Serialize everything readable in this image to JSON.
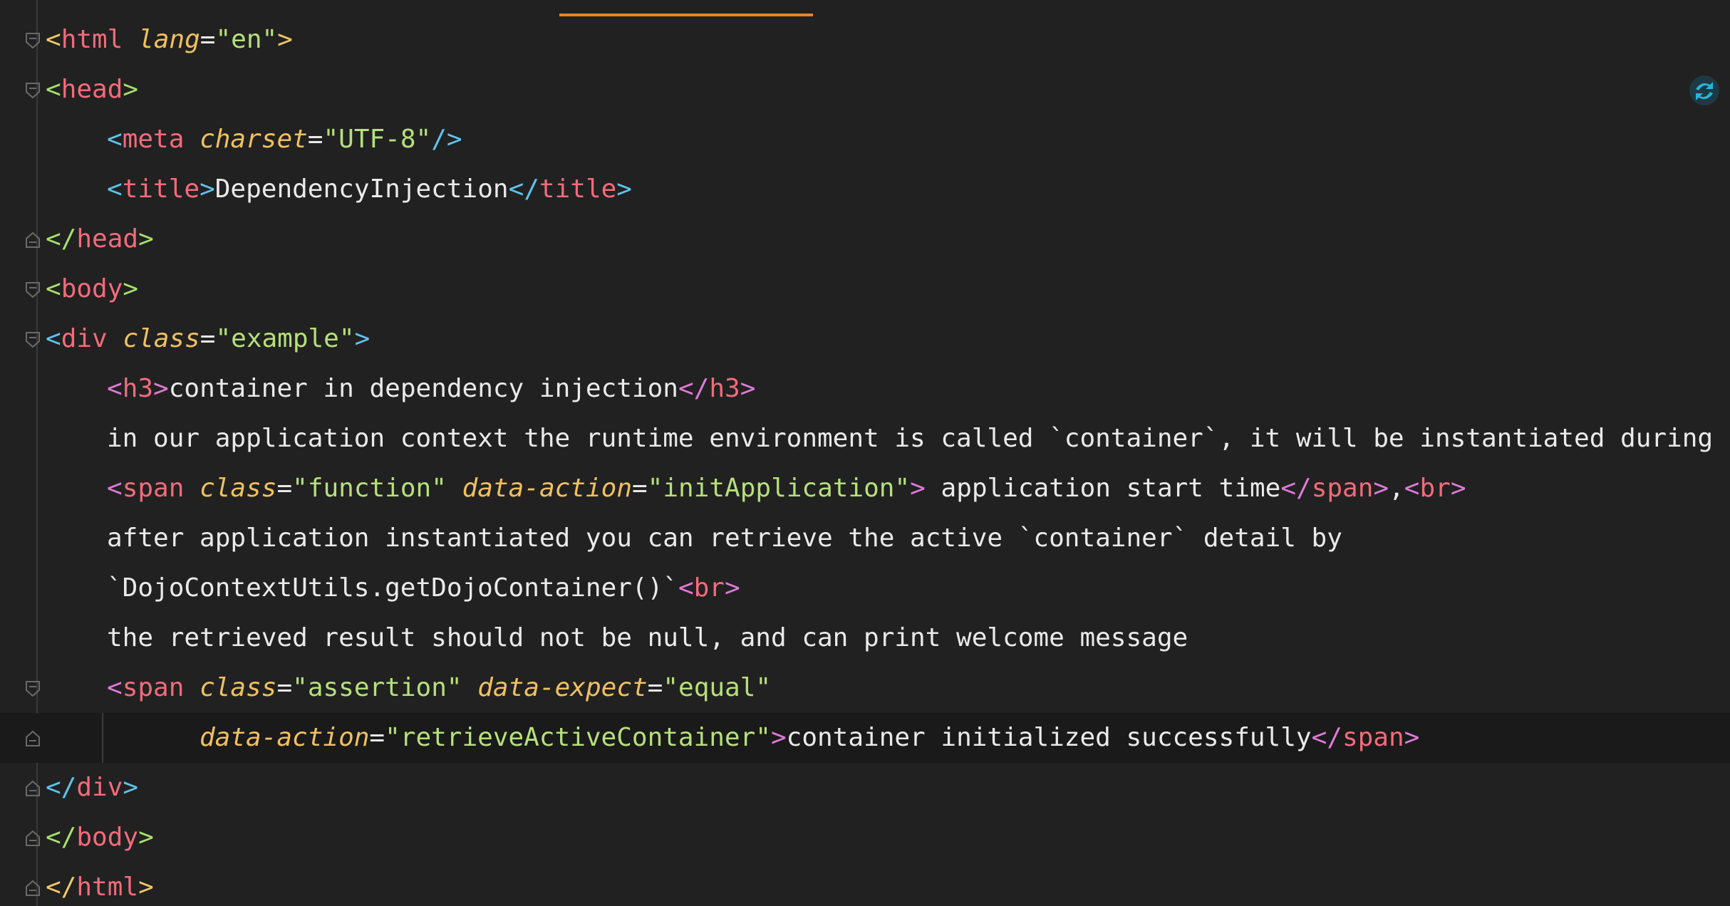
{
  "editor": {
    "lines": [
      {
        "tokens": [
          [
            "tok-bracket-yellow",
            "<"
          ],
          [
            "tok-tag",
            "html"
          ],
          [
            "tok-text",
            " "
          ],
          [
            "tok-attr",
            "lang"
          ],
          [
            "tok-eq",
            "="
          ],
          [
            "tok-string",
            "\"en\""
          ],
          [
            "tok-bracket-yellow",
            ">"
          ]
        ]
      },
      {
        "tokens": [
          [
            "tok-bracket-green",
            "<"
          ],
          [
            "tok-tag",
            "head"
          ],
          [
            "tok-bracket-green",
            ">"
          ]
        ]
      },
      {
        "tokens": [
          [
            "tok-bracket-blue",
            "<"
          ],
          [
            "tok-tag",
            "meta"
          ],
          [
            "tok-text",
            " "
          ],
          [
            "tok-attr",
            "charset"
          ],
          [
            "tok-eq",
            "="
          ],
          [
            "tok-string",
            "\"UTF-8\""
          ],
          [
            "tok-bracket-blue",
            "/>"
          ]
        ]
      },
      {
        "tokens": [
          [
            "tok-bracket-blue",
            "<"
          ],
          [
            "tok-tag",
            "title"
          ],
          [
            "tok-bracket-blue",
            ">"
          ],
          [
            "tok-text",
            "DependencyInjection"
          ],
          [
            "tok-bracket-blue",
            "</"
          ],
          [
            "tok-tag",
            "title"
          ],
          [
            "tok-bracket-blue",
            ">"
          ]
        ]
      },
      {
        "tokens": [
          [
            "tok-bracket-green",
            "</"
          ],
          [
            "tok-tag",
            "head"
          ],
          [
            "tok-bracket-green",
            ">"
          ]
        ]
      },
      {
        "tokens": [
          [
            "tok-bracket-green",
            "<"
          ],
          [
            "tok-tag",
            "body"
          ],
          [
            "tok-bracket-green",
            ">"
          ]
        ]
      },
      {
        "tokens": [
          [
            "tok-bracket-blue",
            "<"
          ],
          [
            "tok-tag",
            "div"
          ],
          [
            "tok-text",
            " "
          ],
          [
            "tok-attr",
            "class"
          ],
          [
            "tok-eq",
            "="
          ],
          [
            "tok-string",
            "\"example\""
          ],
          [
            "tok-bracket-blue",
            ">"
          ]
        ]
      },
      {
        "tokens": [
          [
            "tok-bracket-pink",
            "<"
          ],
          [
            "tok-tag",
            "h3"
          ],
          [
            "tok-bracket-pink",
            ">"
          ],
          [
            "tok-text",
            "container in dependency injection"
          ],
          [
            "tok-bracket-pink",
            "</"
          ],
          [
            "tok-tag",
            "h3"
          ],
          [
            "tok-bracket-pink",
            ">"
          ]
        ]
      },
      {
        "tokens": [
          [
            "tok-text",
            "in our application context the runtime environment is called `container`, it will be instantiated during"
          ]
        ]
      },
      {
        "tokens": [
          [
            "tok-bracket-pink",
            "<"
          ],
          [
            "tok-tag",
            "span"
          ],
          [
            "tok-text",
            " "
          ],
          [
            "tok-attr",
            "class"
          ],
          [
            "tok-eq",
            "="
          ],
          [
            "tok-string",
            "\"function\""
          ],
          [
            "tok-text",
            " "
          ],
          [
            "tok-attr",
            "data-action"
          ],
          [
            "tok-eq",
            "="
          ],
          [
            "tok-string",
            "\"initApplication\""
          ],
          [
            "tok-bracket-pink",
            ">"
          ],
          [
            "tok-text",
            " application start time"
          ],
          [
            "tok-bracket-pink",
            "</"
          ],
          [
            "tok-tag",
            "span"
          ],
          [
            "tok-bracket-pink",
            ">"
          ],
          [
            "tok-text",
            ","
          ],
          [
            "tok-bracket-pink",
            "<"
          ],
          [
            "tok-tag",
            "br"
          ],
          [
            "tok-bracket-pink",
            ">"
          ]
        ]
      },
      {
        "tokens": [
          [
            "tok-text",
            "after application instantiated you can retrieve the active `container` detail by"
          ]
        ]
      },
      {
        "tokens": [
          [
            "tok-text",
            "`DojoContextUtils.getDojoContainer()`"
          ],
          [
            "tok-bracket-pink",
            "<"
          ],
          [
            "tok-tag",
            "br"
          ],
          [
            "tok-bracket-pink",
            ">"
          ]
        ]
      },
      {
        "tokens": [
          [
            "tok-text",
            "the retrieved result should not be null, and can print welcome message"
          ]
        ]
      },
      {
        "tokens": [
          [
            "tok-bracket-pink",
            "<"
          ],
          [
            "tok-tag",
            "span"
          ],
          [
            "tok-text",
            " "
          ],
          [
            "tok-attr",
            "class"
          ],
          [
            "tok-eq",
            "="
          ],
          [
            "tok-string",
            "\"assertion\""
          ],
          [
            "tok-text",
            " "
          ],
          [
            "tok-attr",
            "data-expect"
          ],
          [
            "tok-eq",
            "="
          ],
          [
            "tok-string",
            "\"equal\""
          ]
        ]
      },
      {
        "tokens": [
          [
            "tok-attr",
            "data-action"
          ],
          [
            "tok-eq",
            "="
          ],
          [
            "tok-string",
            "\"retrieveActiveContainer\""
          ],
          [
            "tok-bracket-pink",
            ">"
          ],
          [
            "tok-text",
            "container initialized successfully"
          ],
          [
            "tok-bracket-pink",
            "</"
          ],
          [
            "tok-tag",
            "span"
          ],
          [
            "tok-bracket-pink",
            ">"
          ]
        ]
      },
      {
        "tokens": [
          [
            "tok-bracket-blue",
            "</"
          ],
          [
            "tok-tag",
            "div"
          ],
          [
            "tok-bracket-blue",
            ">"
          ]
        ]
      },
      {
        "tokens": [
          [
            "tok-bracket-green",
            "</"
          ],
          [
            "tok-tag",
            "body"
          ],
          [
            "tok-bracket-green",
            ">"
          ]
        ]
      },
      {
        "tokens": [
          [
            "tok-bracket-yellow",
            "</"
          ],
          [
            "tok-tag",
            "html"
          ],
          [
            "tok-bracket-yellow",
            ">"
          ]
        ]
      }
    ]
  },
  "icons": {
    "fold_open": "fold-open-icon",
    "fold_close": "fold-close-icon",
    "plugin": "plugin-sync-icon"
  },
  "colors": {
    "background": "#212121",
    "current_line": "#1a1a1a",
    "tab_accent": "#e0862c"
  }
}
